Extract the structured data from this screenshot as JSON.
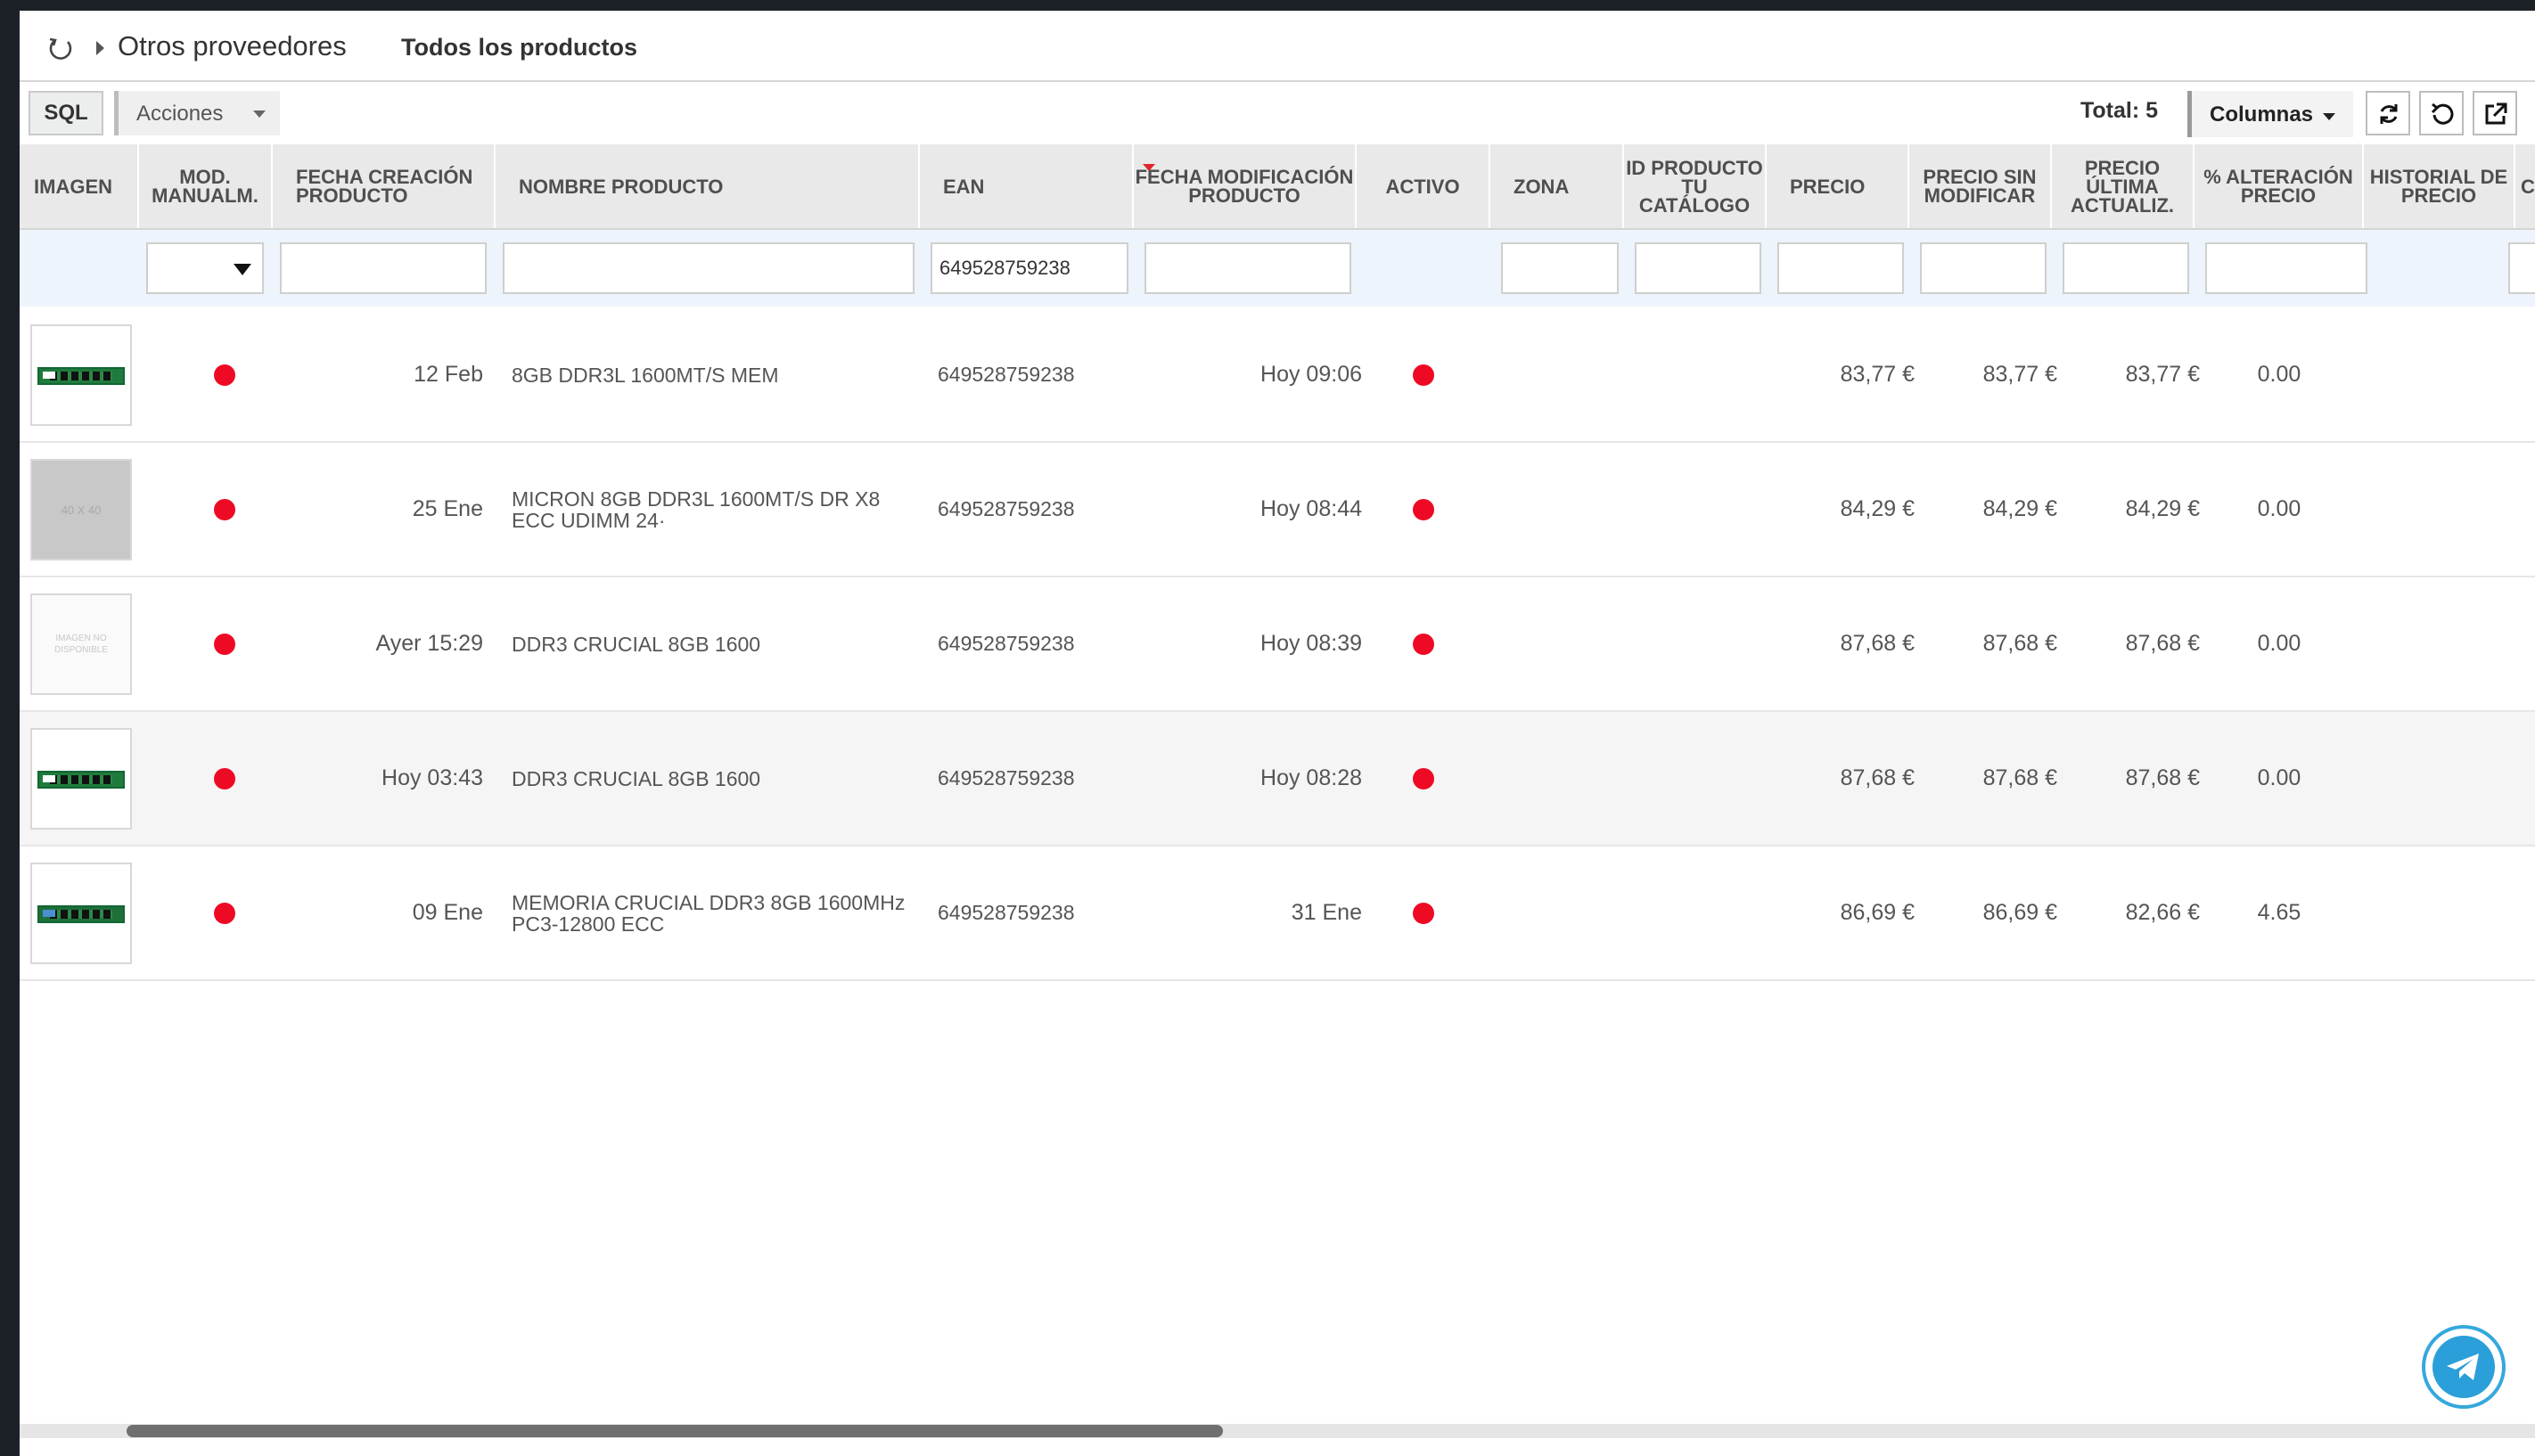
{
  "breadcrumb": {
    "provider": "Otros proveedores",
    "view": "Todos los productos"
  },
  "toolbar": {
    "sql_label": "SQL",
    "acciones_label": "Acciones",
    "total_label": "Total: 5",
    "columnas_label": "Columnas"
  },
  "icons": {
    "breadcrumb": "refresh-circle-icon",
    "refresh": "refresh-icon",
    "reset": "undo-icon",
    "open_external": "external-link-icon",
    "telegram": "telegram-icon"
  },
  "colors": {
    "active_dot": "#ee0a24",
    "sort_indicator": "#e0262d",
    "telegram": "#2b9fd9"
  },
  "table": {
    "headers": {
      "imagen": "IMAGEN",
      "mod": "MOD. MANUALM.",
      "fecha_creacion": "FECHA CREACIÓN PRODUCTO",
      "nombre": "NOMBRE PRODUCTO",
      "ean": "EAN",
      "fecha_mod": "FECHA MODIFICACIÓN PRODUCTO",
      "activo": "ACTIVO",
      "zona": "ZONA",
      "id_catalogo": "ID PRODUCTO TU CATÁLOGO",
      "precio": "PRECIO",
      "precio_sin": "PRECIO SIN MODIFICAR",
      "precio_ultima": "PRECIO ÚLTIMA ACTUALIZ.",
      "alteracion": "% ALTERACIÓN PRECIO",
      "historial": "HISTORIAL DE PRECIO",
      "extra": "C"
    },
    "filters": {
      "ean": "649528759238"
    },
    "rows": [
      {
        "image": "ram-module-green",
        "fecha_creacion": "12 Feb",
        "nombre": "8GB DDR3L 1600MT/S MEM",
        "ean": "649528759238",
        "fecha_mod": "Hoy 09:06",
        "precio": "83,77 €",
        "precio_sin": "83,77 €",
        "precio_ultima": "83,77 €",
        "alteracion": "0.00"
      },
      {
        "image": "placeholder-40x40",
        "placeholder_text": "40 X 40",
        "fecha_creacion": "25 Ene",
        "nombre": "MICRON 8GB DDR3L 1600MT/S DR X8 ECC UDIMM 24·",
        "ean": "649528759238",
        "fecha_mod": "Hoy 08:44",
        "precio": "84,29 €",
        "precio_sin": "84,29 €",
        "precio_ultima": "84,29 €",
        "alteracion": "0.00"
      },
      {
        "image": "imagen-no-disponible",
        "placeholder_text": "IMAGEN NO DISPONIBLE",
        "fecha_creacion": "Ayer 15:29",
        "nombre": "DDR3 CRUCIAL 8GB 1600",
        "ean": "649528759238",
        "fecha_mod": "Hoy 08:39",
        "precio": "87,68 €",
        "precio_sin": "87,68 €",
        "precio_ultima": "87,68 €",
        "alteracion": "0.00"
      },
      {
        "image": "ram-module-green",
        "fecha_creacion": "Hoy 03:43",
        "nombre": "DDR3 CRUCIAL 8GB 1600",
        "ean": "649528759238",
        "fecha_mod": "Hoy 08:28",
        "precio": "87,68 €",
        "precio_sin": "87,68 €",
        "precio_ultima": "87,68 €",
        "alteracion": "0.00"
      },
      {
        "image": "ram-module-green",
        "fecha_creacion": "09 Ene",
        "nombre": "MEMORIA CRUCIAL DDR3 8GB 1600MHz PC3-12800 ECC",
        "ean": "649528759238",
        "fecha_mod": "31 Ene",
        "precio": "86,69 €",
        "precio_sin": "86,69 €",
        "precio_ultima": "82,66 €",
        "alteracion": "4.65"
      }
    ]
  }
}
